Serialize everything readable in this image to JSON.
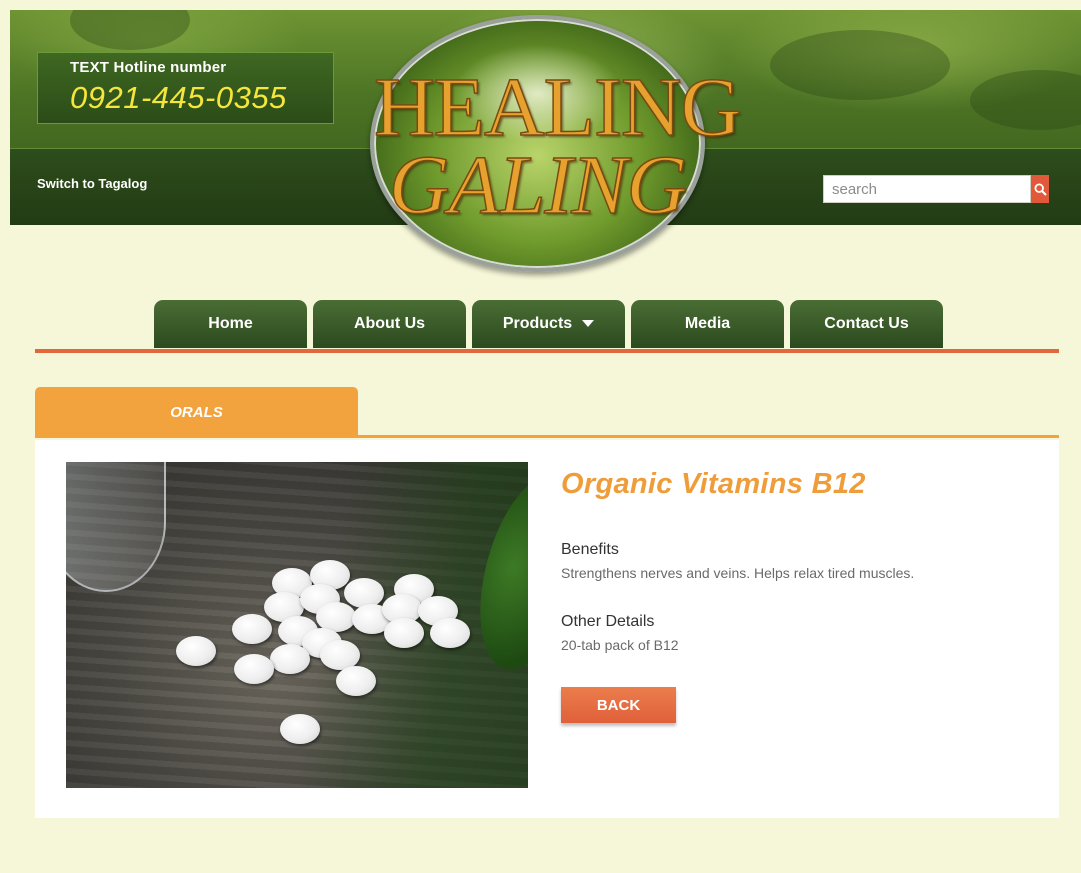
{
  "header": {
    "hotline_label": "TEXT Hotline number",
    "hotline_number": "0921-445-0355",
    "switch_language": "Switch to Tagalog",
    "search_placeholder": "search",
    "logo_line1": "HEALING",
    "logo_line2": "GALING"
  },
  "nav": {
    "items": [
      {
        "label": "Home"
      },
      {
        "label": "About Us"
      },
      {
        "label": "Products",
        "has_dropdown": true
      },
      {
        "label": "Media"
      },
      {
        "label": "Contact Us"
      }
    ]
  },
  "category": {
    "label": "ORALS"
  },
  "product": {
    "title": "Organic Vitamins B12",
    "benefits_label": "Benefits",
    "benefits_text": "Strengthens nerves and veins. Helps relax tired muscles.",
    "details_label": "Other Details",
    "details_text": "20-tab pack of B12",
    "back_label": "BACK"
  },
  "colors": {
    "background": "#f6f7d8",
    "header_green": "#2e4d1c",
    "hotline_yellow": "#f4e63c",
    "nav_accent": "#e1683c",
    "category_orange": "#f3a33e",
    "title_orange": "#ef9d3a",
    "search_button": "#e2583a"
  },
  "icons": {
    "search": "search-icon",
    "dropdown": "caret-down-icon"
  }
}
